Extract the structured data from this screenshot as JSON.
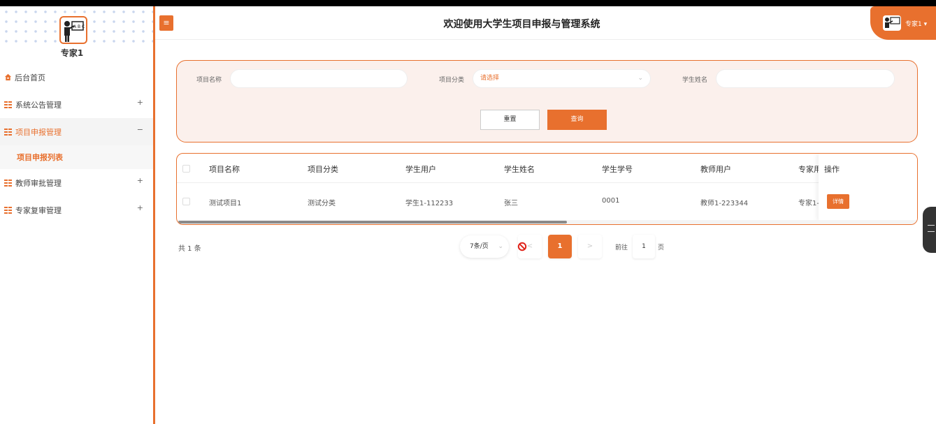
{
  "app": {
    "title": "欢迎使用大学生项目申报与管理系统"
  },
  "user": {
    "name": "专家1",
    "chip_label": "专家1 ▾"
  },
  "sidebar": {
    "items": [
      {
        "label": "后台首页",
        "toggle": ""
      },
      {
        "label": "系统公告管理",
        "toggle": "+"
      },
      {
        "label": "项目申报管理",
        "toggle": "−"
      },
      {
        "label": "教师审批管理",
        "toggle": "+"
      },
      {
        "label": "专家复审管理",
        "toggle": "+"
      }
    ],
    "subitem": "项目申报列表"
  },
  "header": {
    "menu_toggle": "≡"
  },
  "search": {
    "project_name_label": "项目名称",
    "project_name_value": "",
    "category_label": "项目分类",
    "category_placeholder": "请选择",
    "student_name_label": "学生姓名",
    "student_name_value": "",
    "reset_label": "重置",
    "query_label": "查询"
  },
  "table": {
    "columns": [
      "项目名称",
      "项目分类",
      "学生用户",
      "学生姓名",
      "学生学号",
      "教师用户",
      "专家用户"
    ],
    "column_truncated": "专家用",
    "op_header": "操作",
    "rows": [
      {
        "cells": [
          "测试项目1",
          "测试分类",
          "学生1-112233",
          "张三",
          "0001",
          "教师1-223344",
          "专家1-"
        ],
        "action": "详情"
      }
    ]
  },
  "pagination": {
    "total": "共 1 条",
    "page_size": "7条/页",
    "current_page": "1",
    "goto_label": "前往",
    "goto_value": "1",
    "goto_suffix": "页",
    "prev": "<",
    "next": ">"
  },
  "colors": {
    "accent": "#e8702e",
    "panel_bg": "#fbf0ec"
  }
}
